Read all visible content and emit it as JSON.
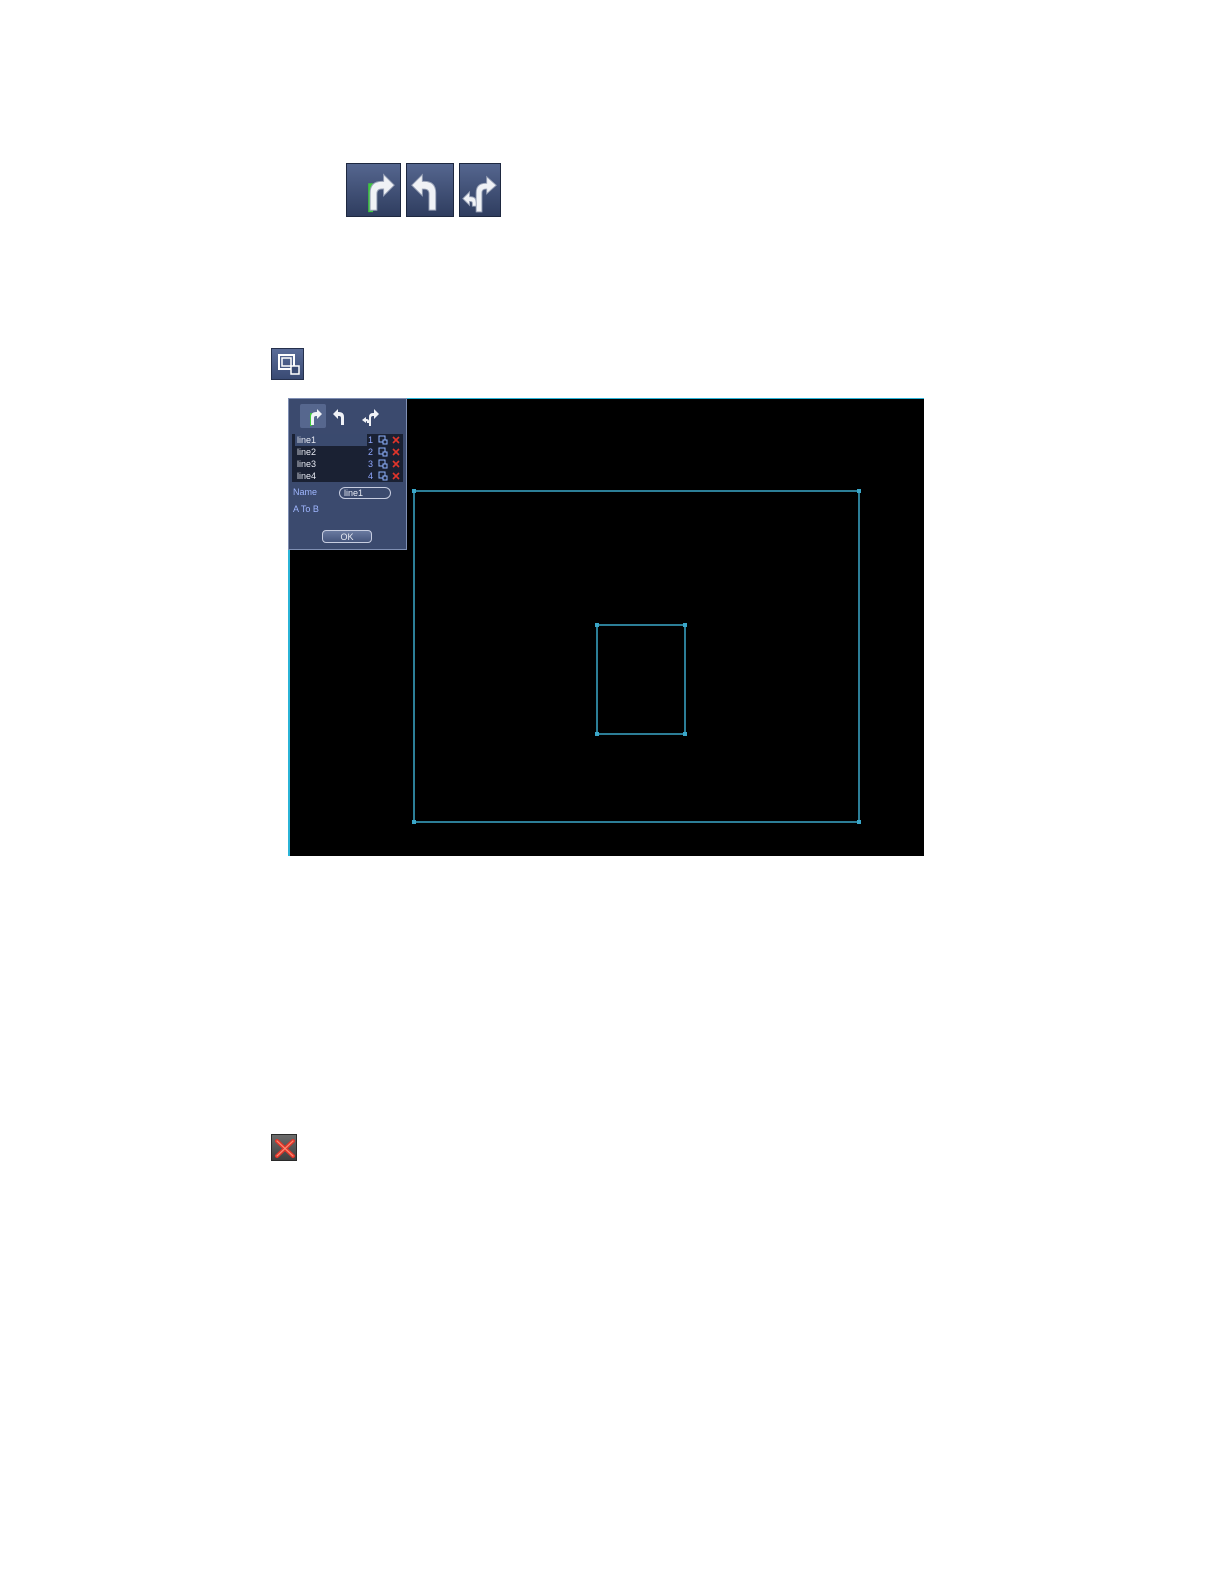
{
  "icons": {
    "direction_a_to_b": "right-turn-arrow-icon",
    "direction_b_to_a": "left-turn-arrow-icon",
    "direction_both": "bidirectional-arrow-icon",
    "edit": "edit-region-icon",
    "delete": "delete-x-icon"
  },
  "panel": {
    "lines": [
      {
        "name": "line1",
        "number": "1"
      },
      {
        "name": "line2",
        "number": "2"
      },
      {
        "name": "line3",
        "number": "3"
      },
      {
        "name": "line4",
        "number": "4"
      }
    ],
    "name_label": "Name",
    "name_value": "line1",
    "direction_label": "A To B",
    "ok_label": "OK"
  },
  "colors": {
    "accent": "#2bb3d6",
    "panel_bg": "#3b4a6e",
    "region_line": "#3aa7c9",
    "delete_red": "#e0352b"
  }
}
